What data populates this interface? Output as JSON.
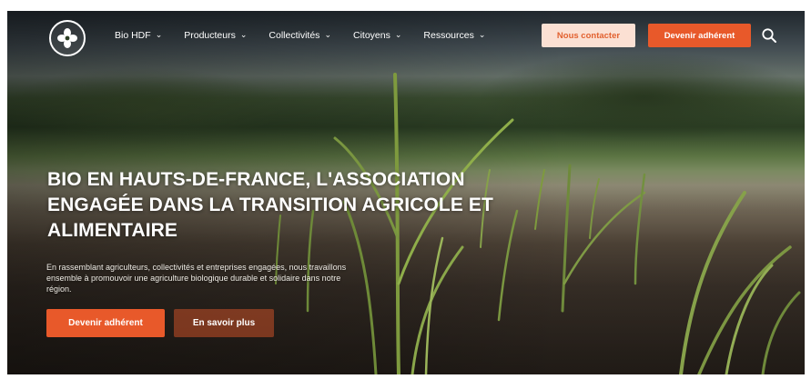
{
  "header": {
    "logo_icon": "clover-flower-icon",
    "nav": [
      {
        "label": "Bio HDF",
        "icon": "chevron-down-icon"
      },
      {
        "label": "Producteurs",
        "icon": "chevron-down-icon"
      },
      {
        "label": "Collectivités",
        "icon": "chevron-down-icon"
      },
      {
        "label": "Citoyens",
        "icon": "chevron-down-icon"
      },
      {
        "label": "Ressources",
        "icon": "chevron-down-icon"
      }
    ],
    "contact_label": "Nous contacter",
    "join_label": "Devenir adhérent",
    "search_icon": "search-icon"
  },
  "hero": {
    "title": "BIO EN HAUTS-DE-FRANCE, L'ASSOCIATION ENGAGÉE DANS LA TRANSITION AGRICOLE ET ALIMENTAIRE",
    "description": "En rassemblant agriculteurs, collectivités et entreprises engagées, nous travaillons ensemble à promouvoir une agriculture biologique durable et solidaire dans notre région.",
    "primary_label": "Devenir adhérent",
    "secondary_label": "En savoir plus"
  },
  "colors": {
    "accent": "#e8592a",
    "accent_light": "#fbe0d3",
    "text_on_dark": "#ffffff"
  }
}
